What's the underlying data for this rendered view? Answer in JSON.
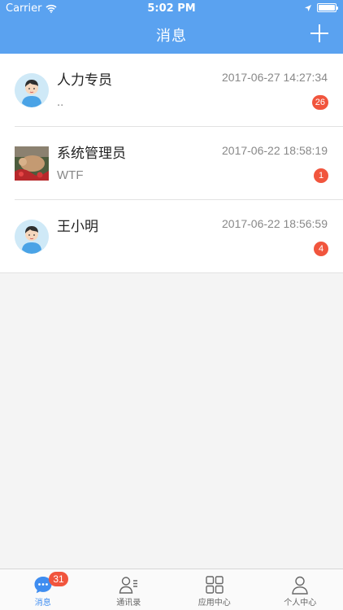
{
  "status_bar": {
    "carrier": "Carrier",
    "time": "5:02 PM"
  },
  "header": {
    "title": "消息",
    "icon": "plus-icon"
  },
  "conversations": [
    {
      "name": "人力专员",
      "timestamp": "2017-06-27 14:27:34",
      "preview": "..",
      "unread": "26",
      "avatar": "cartoon-person"
    },
    {
      "name": "系统管理员",
      "timestamp": "2017-06-22 18:58:19",
      "preview": "WTF",
      "unread": "1",
      "avatar": "photo"
    },
    {
      "name": "王小明",
      "timestamp": "2017-06-22 18:56:59",
      "preview": "",
      "unread": "4",
      "avatar": "cartoon-person"
    }
  ],
  "tabbar": {
    "items": [
      {
        "label": "消息",
        "icon": "chat-bubble-icon",
        "badge": "31",
        "active": true
      },
      {
        "label": "通讯录",
        "icon": "contacts-icon"
      },
      {
        "label": "应用中心",
        "icon": "grid-icon"
      },
      {
        "label": "个人中心",
        "icon": "person-icon"
      }
    ]
  },
  "colors": {
    "header": "#5aa2f0",
    "badge": "#f1553d",
    "active_tab": "#3f8df0"
  }
}
